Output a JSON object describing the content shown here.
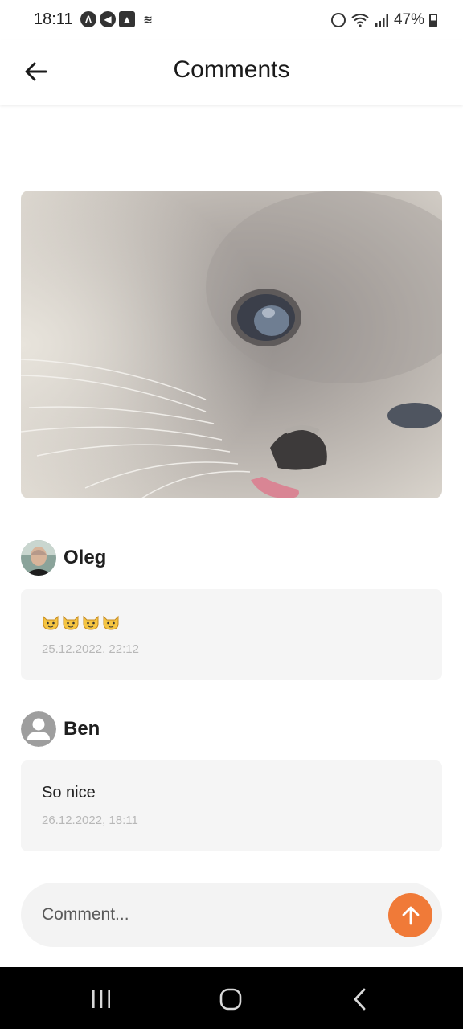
{
  "status_bar": {
    "time": "18:11",
    "battery": "47%"
  },
  "header": {
    "title": "Comments",
    "back_icon": "arrow-left-icon"
  },
  "post": {
    "image": "cat-photo"
  },
  "comments": [
    {
      "author": "Oleg",
      "text": "😺😺😺😺",
      "date": "25.12.2022, 22:12",
      "avatar": "photo-avatar"
    },
    {
      "author": "Ben",
      "text": "So nice",
      "date": "26.12.2022, 18:11",
      "avatar": "default-person-avatar"
    }
  ],
  "composer": {
    "placeholder": "Comment...",
    "send_icon": "arrow-up-icon"
  },
  "colors": {
    "accent": "#f07a38",
    "card_bg": "#f5f5f5",
    "date_text": "#b8b8b8"
  }
}
